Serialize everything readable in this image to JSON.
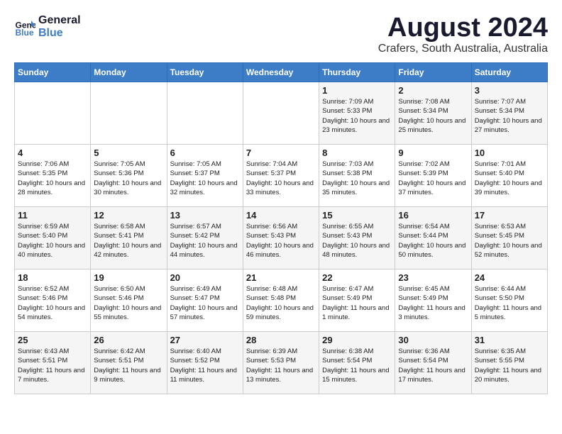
{
  "header": {
    "logo_line1": "General",
    "logo_line2": "Blue",
    "month_year": "August 2024",
    "location": "Crafers, South Australia, Australia"
  },
  "days_of_week": [
    "Sunday",
    "Monday",
    "Tuesday",
    "Wednesday",
    "Thursday",
    "Friday",
    "Saturday"
  ],
  "weeks": [
    [
      {
        "day": "",
        "content": ""
      },
      {
        "day": "",
        "content": ""
      },
      {
        "day": "",
        "content": ""
      },
      {
        "day": "",
        "content": ""
      },
      {
        "day": "1",
        "content": "Sunrise: 7:09 AM\nSunset: 5:33 PM\nDaylight: 10 hours\nand 23 minutes."
      },
      {
        "day": "2",
        "content": "Sunrise: 7:08 AM\nSunset: 5:34 PM\nDaylight: 10 hours\nand 25 minutes."
      },
      {
        "day": "3",
        "content": "Sunrise: 7:07 AM\nSunset: 5:34 PM\nDaylight: 10 hours\nand 27 minutes."
      }
    ],
    [
      {
        "day": "4",
        "content": "Sunrise: 7:06 AM\nSunset: 5:35 PM\nDaylight: 10 hours\nand 28 minutes."
      },
      {
        "day": "5",
        "content": "Sunrise: 7:05 AM\nSunset: 5:36 PM\nDaylight: 10 hours\nand 30 minutes."
      },
      {
        "day": "6",
        "content": "Sunrise: 7:05 AM\nSunset: 5:37 PM\nDaylight: 10 hours\nand 32 minutes."
      },
      {
        "day": "7",
        "content": "Sunrise: 7:04 AM\nSunset: 5:37 PM\nDaylight: 10 hours\nand 33 minutes."
      },
      {
        "day": "8",
        "content": "Sunrise: 7:03 AM\nSunset: 5:38 PM\nDaylight: 10 hours\nand 35 minutes."
      },
      {
        "day": "9",
        "content": "Sunrise: 7:02 AM\nSunset: 5:39 PM\nDaylight: 10 hours\nand 37 minutes."
      },
      {
        "day": "10",
        "content": "Sunrise: 7:01 AM\nSunset: 5:40 PM\nDaylight: 10 hours\nand 39 minutes."
      }
    ],
    [
      {
        "day": "11",
        "content": "Sunrise: 6:59 AM\nSunset: 5:40 PM\nDaylight: 10 hours\nand 40 minutes."
      },
      {
        "day": "12",
        "content": "Sunrise: 6:58 AM\nSunset: 5:41 PM\nDaylight: 10 hours\nand 42 minutes."
      },
      {
        "day": "13",
        "content": "Sunrise: 6:57 AM\nSunset: 5:42 PM\nDaylight: 10 hours\nand 44 minutes."
      },
      {
        "day": "14",
        "content": "Sunrise: 6:56 AM\nSunset: 5:43 PM\nDaylight: 10 hours\nand 46 minutes."
      },
      {
        "day": "15",
        "content": "Sunrise: 6:55 AM\nSunset: 5:43 PM\nDaylight: 10 hours\nand 48 minutes."
      },
      {
        "day": "16",
        "content": "Sunrise: 6:54 AM\nSunset: 5:44 PM\nDaylight: 10 hours\nand 50 minutes."
      },
      {
        "day": "17",
        "content": "Sunrise: 6:53 AM\nSunset: 5:45 PM\nDaylight: 10 hours\nand 52 minutes."
      }
    ],
    [
      {
        "day": "18",
        "content": "Sunrise: 6:52 AM\nSunset: 5:46 PM\nDaylight: 10 hours\nand 54 minutes."
      },
      {
        "day": "19",
        "content": "Sunrise: 6:50 AM\nSunset: 5:46 PM\nDaylight: 10 hours\nand 55 minutes."
      },
      {
        "day": "20",
        "content": "Sunrise: 6:49 AM\nSunset: 5:47 PM\nDaylight: 10 hours\nand 57 minutes."
      },
      {
        "day": "21",
        "content": "Sunrise: 6:48 AM\nSunset: 5:48 PM\nDaylight: 10 hours\nand 59 minutes."
      },
      {
        "day": "22",
        "content": "Sunrise: 6:47 AM\nSunset: 5:49 PM\nDaylight: 11 hours\nand 1 minute."
      },
      {
        "day": "23",
        "content": "Sunrise: 6:45 AM\nSunset: 5:49 PM\nDaylight: 11 hours\nand 3 minutes."
      },
      {
        "day": "24",
        "content": "Sunrise: 6:44 AM\nSunset: 5:50 PM\nDaylight: 11 hours\nand 5 minutes."
      }
    ],
    [
      {
        "day": "25",
        "content": "Sunrise: 6:43 AM\nSunset: 5:51 PM\nDaylight: 11 hours\nand 7 minutes."
      },
      {
        "day": "26",
        "content": "Sunrise: 6:42 AM\nSunset: 5:51 PM\nDaylight: 11 hours\nand 9 minutes."
      },
      {
        "day": "27",
        "content": "Sunrise: 6:40 AM\nSunset: 5:52 PM\nDaylight: 11 hours\nand 11 minutes."
      },
      {
        "day": "28",
        "content": "Sunrise: 6:39 AM\nSunset: 5:53 PM\nDaylight: 11 hours\nand 13 minutes."
      },
      {
        "day": "29",
        "content": "Sunrise: 6:38 AM\nSunset: 5:54 PM\nDaylight: 11 hours\nand 15 minutes."
      },
      {
        "day": "30",
        "content": "Sunrise: 6:36 AM\nSunset: 5:54 PM\nDaylight: 11 hours\nand 17 minutes."
      },
      {
        "day": "31",
        "content": "Sunrise: 6:35 AM\nSunset: 5:55 PM\nDaylight: 11 hours\nand 20 minutes."
      }
    ]
  ]
}
